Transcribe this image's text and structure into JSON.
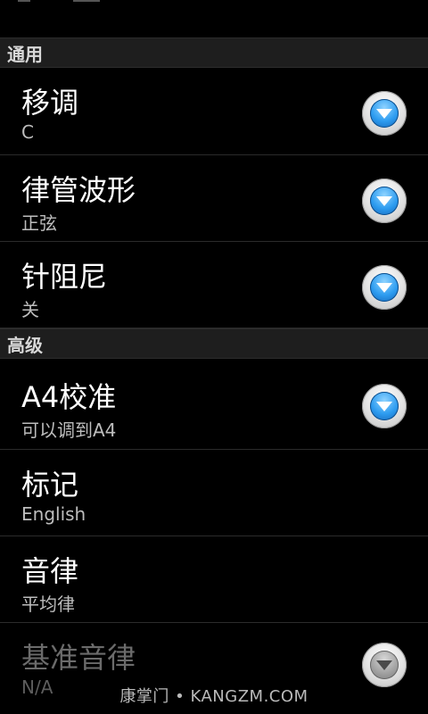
{
  "sections": [
    {
      "header": "通用",
      "items": [
        {
          "title": "移调",
          "summary": "C",
          "icon": "dropdown-arrow-icon"
        },
        {
          "title": "律管波形",
          "summary": "正弦",
          "icon": "dropdown-arrow-icon"
        },
        {
          "title": "针阻尼",
          "summary": "关",
          "icon": "dropdown-arrow-icon"
        }
      ]
    },
    {
      "header": "高级",
      "items": [
        {
          "title": "A4校准",
          "summary": "可以调到A4",
          "icon": "dropdown-arrow-icon"
        },
        {
          "title": "标记",
          "summary": "English"
        },
        {
          "title": "音律",
          "summary": "平均律"
        },
        {
          "title": "基准音律",
          "summary": "N/A",
          "disabled": true,
          "icon": "dropdown-arrow-icon"
        }
      ]
    }
  ],
  "watermark": "康掌门 • KANGZM.COM",
  "colors": {
    "accent": "#2d9cf0",
    "background": "#000000",
    "section_header_bg": "#1e1e1e"
  }
}
